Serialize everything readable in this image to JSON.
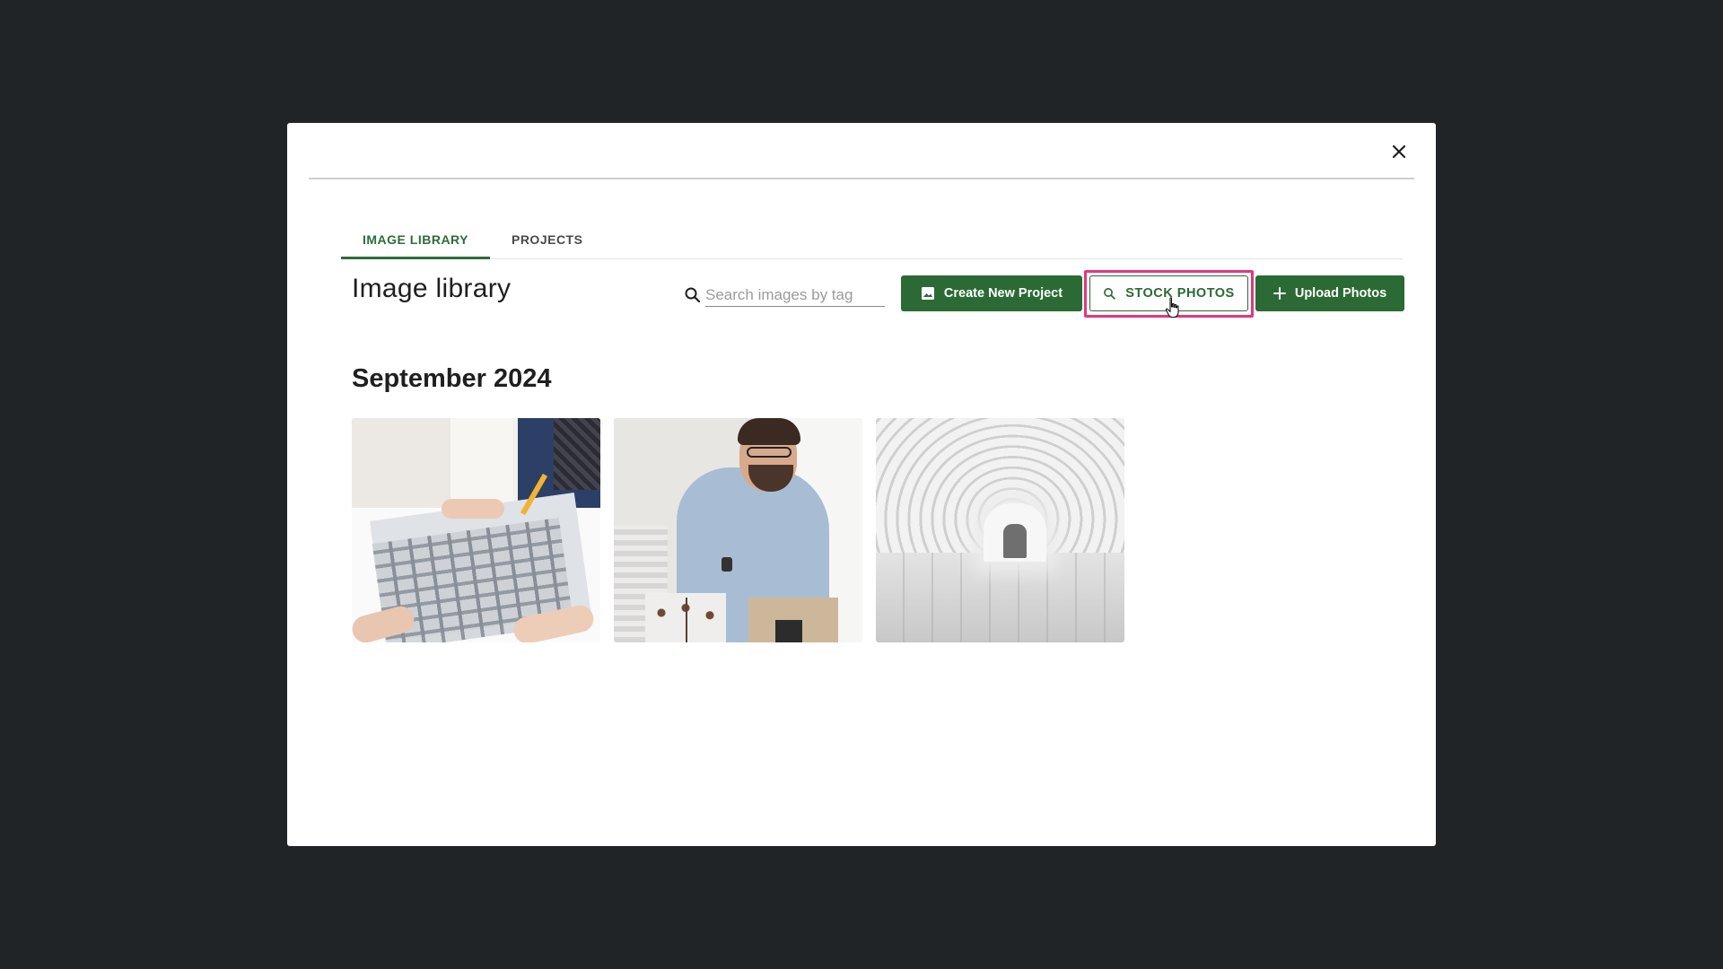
{
  "modal": {
    "close_icon": "close-icon"
  },
  "tabs": [
    {
      "label": "IMAGE LIBRARY",
      "active": true
    },
    {
      "label": "PROJECTS",
      "active": false
    }
  ],
  "header": {
    "title": "Image library"
  },
  "search": {
    "icon": "search-icon",
    "placeholder": "Search images by tag",
    "value": ""
  },
  "toolbar": {
    "create_label": "Create New Project",
    "create_icon": "image-icon",
    "stock_label": "STOCK PHOTOS",
    "stock_icon": "search-icon",
    "upload_label": "Upload Photos",
    "upload_icon": "plus-icon"
  },
  "gallery": {
    "section_title": "September 2024",
    "images": [
      {
        "subject": "team reviewing architectural prints"
      },
      {
        "subject": "designer working at desk"
      },
      {
        "subject": "white arched corridor"
      }
    ]
  },
  "colors": {
    "backdrop": "#212427",
    "accent_green": "#2b6a34",
    "highlight_pink": "#e6367a"
  }
}
